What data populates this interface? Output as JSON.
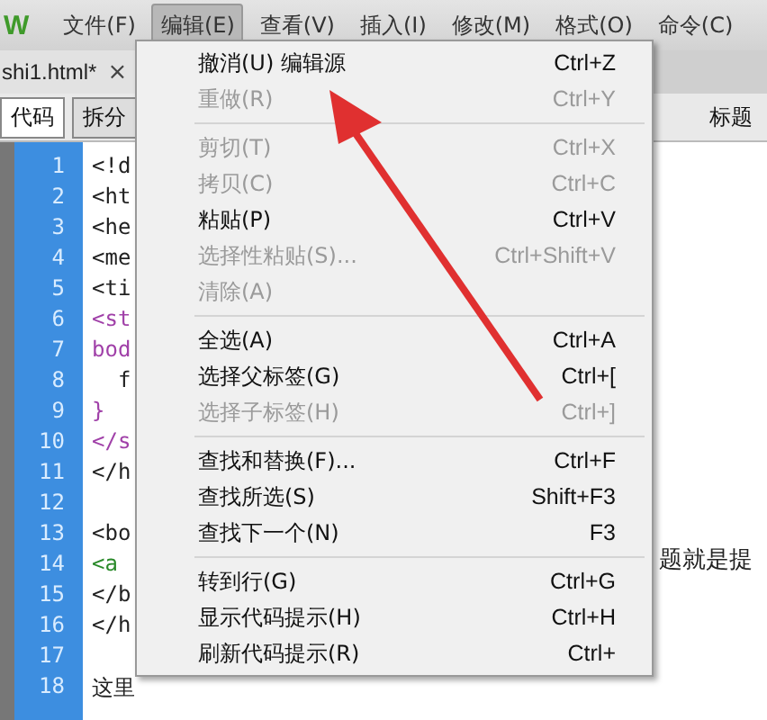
{
  "menu_bar": {
    "logo": "W",
    "items": [
      {
        "label": "文件(F)",
        "selected": false
      },
      {
        "label": "编辑(E)",
        "selected": true
      },
      {
        "label": "查看(V)",
        "selected": false
      },
      {
        "label": "插入(I)",
        "selected": false
      },
      {
        "label": "修改(M)",
        "selected": false
      },
      {
        "label": "格式(O)",
        "selected": false
      },
      {
        "label": "命令(C)",
        "selected": false
      }
    ]
  },
  "document_tab": {
    "title": "shi1.html*",
    "close": "×"
  },
  "view_buttons": [
    {
      "label": "代码",
      "selected": true
    },
    {
      "label": "拆分",
      "selected": false
    }
  ],
  "toolbar_title": "标题",
  "code_lines": [
    {
      "number": "1",
      "text": "<!d",
      "kind": "markup"
    },
    {
      "number": "2",
      "text": "<ht",
      "kind": "markup"
    },
    {
      "number": "3",
      "text": "<he",
      "kind": "markup"
    },
    {
      "number": "4",
      "text": "<me",
      "kind": "markup"
    },
    {
      "number": "5",
      "text": "<ti",
      "kind": "markup"
    },
    {
      "number": "6",
      "text": "<st",
      "kind": "style"
    },
    {
      "number": "7",
      "text": "bod",
      "kind": "style"
    },
    {
      "number": "8",
      "text": "  f",
      "kind": "markup"
    },
    {
      "number": "9",
      "text": "}",
      "kind": "style"
    },
    {
      "number": "10",
      "text": "</s",
      "kind": "style"
    },
    {
      "number": "11",
      "text": "</h",
      "kind": "markup"
    },
    {
      "number": "12",
      "kind": "markup"
    },
    {
      "number": "13",
      "text": "<bo",
      "kind": "markup"
    },
    {
      "number": "14",
      "text": "<a",
      "kind": "link"
    },
    {
      "number": "15",
      "text": "</b",
      "kind": "markup"
    },
    {
      "number": "16",
      "text": "</h",
      "kind": "markup"
    },
    {
      "number": "17",
      "kind": "markup"
    },
    {
      "number": "18",
      "text": "这里",
      "kind": "text"
    }
  ],
  "page_text": "题就是提",
  "edit_menu": {
    "groups": [
      [
        {
          "label": "撤消(U) 编辑源",
          "shortcut": "Ctrl+Z",
          "disabled": false
        },
        {
          "label": "重做(R)",
          "shortcut": "Ctrl+Y",
          "disabled": true
        }
      ],
      [
        {
          "label": "剪切(T)",
          "shortcut": "Ctrl+X",
          "disabled": true
        },
        {
          "label": "拷贝(C)",
          "shortcut": "Ctrl+C",
          "disabled": true
        },
        {
          "label": "粘贴(P)",
          "shortcut": "Ctrl+V",
          "disabled": false
        },
        {
          "label": "选择性粘贴(S)...",
          "shortcut": "Ctrl+Shift+V",
          "disabled": true
        },
        {
          "label": "清除(A)",
          "disabled": true
        }
      ],
      [
        {
          "label": "全选(A)",
          "shortcut": "Ctrl+A",
          "disabled": false
        },
        {
          "label": "选择父标签(G)",
          "shortcut": "Ctrl+[",
          "disabled": false
        },
        {
          "label": "选择子标签(H)",
          "shortcut": "Ctrl+]",
          "disabled": true
        }
      ],
      [
        {
          "label": "查找和替换(F)...",
          "shortcut": "Ctrl+F",
          "disabled": false
        },
        {
          "label": "查找所选(S)",
          "shortcut": "Shift+F3",
          "disabled": false
        },
        {
          "label": "查找下一个(N)",
          "shortcut": "F3",
          "disabled": false
        }
      ],
      [
        {
          "label": "转到行(G)",
          "shortcut": "Ctrl+G",
          "disabled": false
        },
        {
          "label": "显示代码提示(H)",
          "shortcut": "Ctrl+H",
          "disabled": false
        },
        {
          "label": "刷新代码提示(R)",
          "shortcut": "Ctrl+",
          "disabled": false
        }
      ]
    ]
  }
}
